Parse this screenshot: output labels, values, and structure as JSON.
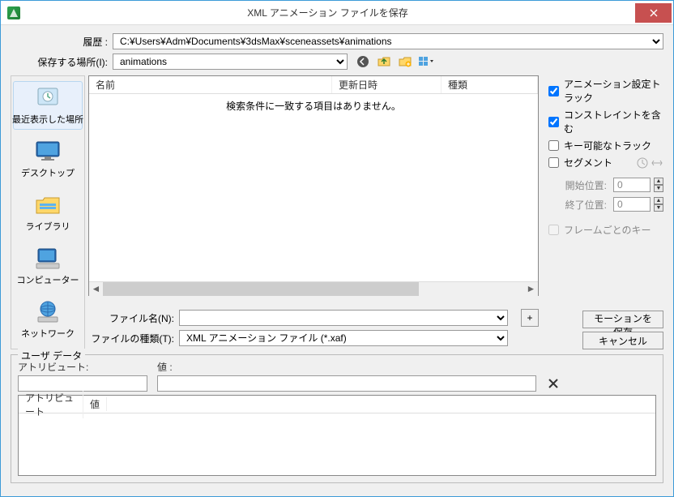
{
  "titlebar": {
    "title": "XML アニメーション ファイルを保存"
  },
  "history": {
    "label": "履歴 :",
    "value": "C:¥Users¥Adm¥Documents¥3dsMax¥sceneassets¥animations"
  },
  "savein": {
    "label": "保存する場所(I):",
    "value": "animations"
  },
  "columns": {
    "name": "名前",
    "date": "更新日時",
    "type": "種類"
  },
  "list": {
    "empty": "検索条件に一致する項目はありません。"
  },
  "places": {
    "recent": "最近表示した場所",
    "desktop": "デスクトップ",
    "libraries": "ライブラリ",
    "computer": "コンピューター",
    "network": "ネットワーク"
  },
  "file": {
    "name_label": "ファイル名(N):",
    "name_value": "",
    "type_label": "ファイルの種類(T):",
    "type_value": "XML アニメーション ファイル (*.xaf)"
  },
  "options": {
    "anim_tracks": "アニメーション設定トラック",
    "constraints": "コンストレイントを含む",
    "keyable": "キー可能なトラック",
    "segment": "セグメント",
    "start_label": "開始位置:",
    "start_value": "0",
    "end_label": "終了位置:",
    "end_value": "0",
    "per_frame": "フレームごとのキー"
  },
  "actions": {
    "save": "モーションを保存",
    "cancel": "キャンセル",
    "plus": "+"
  },
  "userdata": {
    "legend": "ユーザ データ",
    "attr_label": "アトリビュート:",
    "val_label": "値 :",
    "col_attr": "アトリビュート",
    "col_val": "値"
  }
}
